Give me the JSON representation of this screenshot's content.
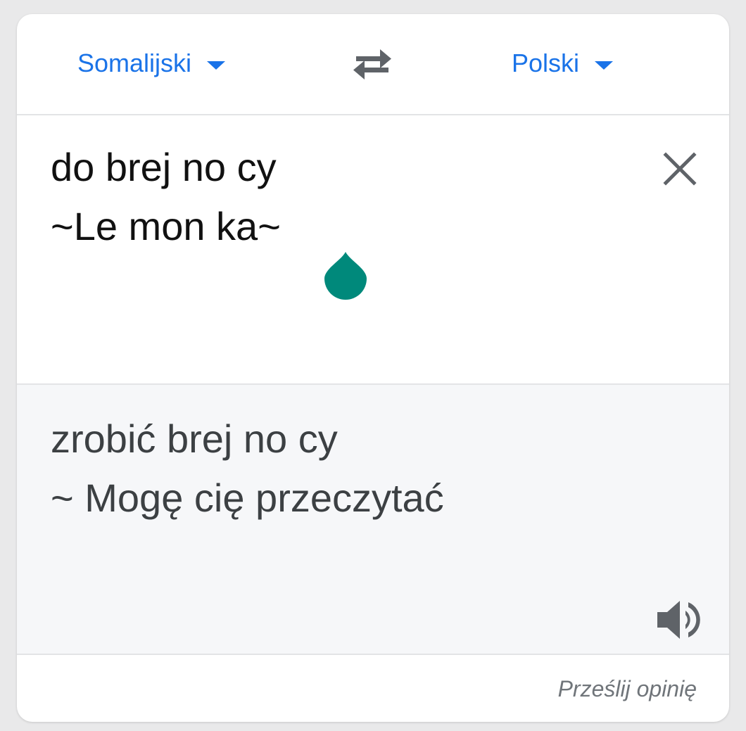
{
  "languages": {
    "source": "Somalijski",
    "target": "Polski"
  },
  "source": {
    "line1": "do brej no cy",
    "line2": "~Le mon ka~"
  },
  "result": {
    "line1": "zrobić brej no cy",
    "line2": "~ Mogę cię przeczytać"
  },
  "footer": {
    "feedback_label": "Prześlij opinię"
  },
  "icons": {
    "dropdown": "caret-down-icon",
    "swap": "swap-arrows-icon",
    "clear": "close-icon",
    "cursor_handle": "text-cursor-handle-icon",
    "speaker": "speaker-icon"
  },
  "colors": {
    "accent": "#1a73e8",
    "handle": "#00897b",
    "result_bg": "#f6f7f9",
    "icon_gray": "#5f6368"
  }
}
